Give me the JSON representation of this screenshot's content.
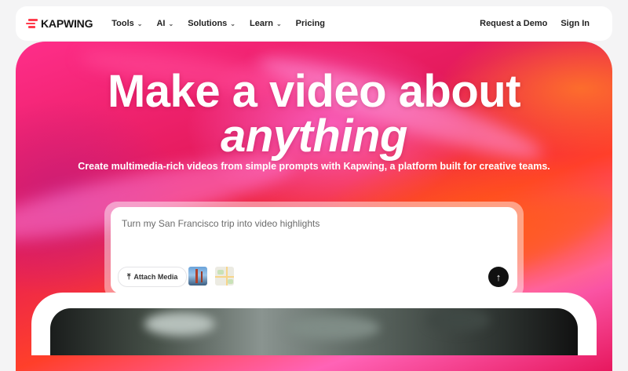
{
  "nav": {
    "logo": "KAPWING",
    "items": [
      {
        "label": "Tools",
        "has_dropdown": true
      },
      {
        "label": "AI",
        "has_dropdown": true
      },
      {
        "label": "Solutions",
        "has_dropdown": true
      },
      {
        "label": "Learn",
        "has_dropdown": true
      },
      {
        "label": "Pricing",
        "has_dropdown": false
      }
    ],
    "request_demo": "Request a Demo",
    "sign_in": "Sign In"
  },
  "hero": {
    "headline_line1": "Make a video about",
    "headline_line2": "anything",
    "subtitle": "Create multimedia-rich videos from simple prompts with Kapwing, a platform built for creative teams."
  },
  "prompt": {
    "placeholder": "Turn my San Francisco trip into video highlights",
    "attach_label": "Attach Media",
    "send_icon": "arrow-up-icon"
  },
  "colors": {
    "brand": "#ff3c4d",
    "hero_pink": "#ff2e8a",
    "hero_orange": "#ff3f2a",
    "send_button": "#111111"
  }
}
